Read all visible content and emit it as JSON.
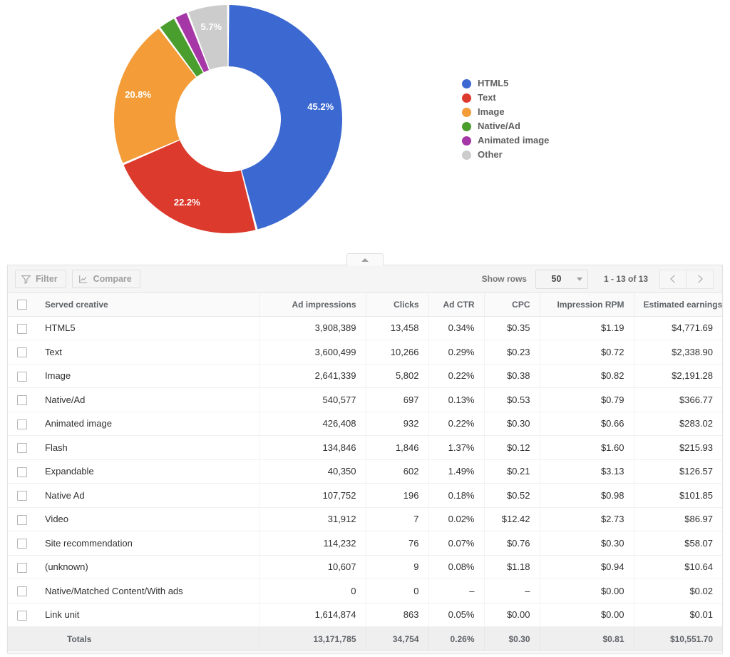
{
  "chart_data": {
    "type": "pie",
    "variant": "donut",
    "title": "",
    "legend_position": "right",
    "categories": [
      "HTML5",
      "Text",
      "Image",
      "Native/Ad",
      "Animated image",
      "Other"
    ],
    "values": [
      45.2,
      22.2,
      20.8,
      2.5,
      1.9,
      5.7
    ],
    "value_unit": "percent",
    "labels_shown": [
      "45.2%",
      "22.2%",
      "20.8%",
      "",
      "",
      "5.7%"
    ],
    "colors": [
      "#3b68d1",
      "#dc3a2c",
      "#f39c38",
      "#4a9e2e",
      "#a637a6",
      "#cccccc"
    ],
    "legend": [
      {
        "label": "HTML5",
        "color": "#3b68d1"
      },
      {
        "label": "Text",
        "color": "#dc3a2c"
      },
      {
        "label": "Image",
        "color": "#f39c38"
      },
      {
        "label": "Native/Ad",
        "color": "#4a9e2e"
      },
      {
        "label": "Animated image",
        "color": "#a637a6"
      },
      {
        "label": "Other",
        "color": "#cccccc"
      }
    ]
  },
  "collapse_tab": {
    "icon": "triangle-up-icon"
  },
  "toolbar": {
    "filter_label": "Filter",
    "compare_label": "Compare",
    "show_rows_label": "Show rows",
    "rows_value": "50",
    "page_range": "1 - 13 of 13",
    "prev_icon": "chevron-left-icon",
    "next_icon": "chevron-right-icon"
  },
  "table": {
    "columns": [
      "Served creative",
      "Ad impressions",
      "Clicks",
      "Ad CTR",
      "CPC",
      "Impression RPM",
      "Estimated earnings"
    ],
    "rows": [
      {
        "name": "HTML5",
        "impressions": "3,908,389",
        "clicks": "13,458",
        "ctr": "0.34%",
        "cpc": "$0.35",
        "rpm": "$1.19",
        "earnings": "$4,771.69"
      },
      {
        "name": "Text",
        "impressions": "3,600,499",
        "clicks": "10,266",
        "ctr": "0.29%",
        "cpc": "$0.23",
        "rpm": "$0.72",
        "earnings": "$2,338.90"
      },
      {
        "name": "Image",
        "impressions": "2,641,339",
        "clicks": "5,802",
        "ctr": "0.22%",
        "cpc": "$0.38",
        "rpm": "$0.82",
        "earnings": "$2,191.28"
      },
      {
        "name": "Native/Ad",
        "impressions": "540,577",
        "clicks": "697",
        "ctr": "0.13%",
        "cpc": "$0.53",
        "rpm": "$0.79",
        "earnings": "$366.77"
      },
      {
        "name": "Animated image",
        "impressions": "426,408",
        "clicks": "932",
        "ctr": "0.22%",
        "cpc": "$0.30",
        "rpm": "$0.66",
        "earnings": "$283.02"
      },
      {
        "name": "Flash",
        "impressions": "134,846",
        "clicks": "1,846",
        "ctr": "1.37%",
        "cpc": "$0.12",
        "rpm": "$1.60",
        "earnings": "$215.93"
      },
      {
        "name": "Expandable",
        "impressions": "40,350",
        "clicks": "602",
        "ctr": "1.49%",
        "cpc": "$0.21",
        "rpm": "$3.13",
        "earnings": "$126.57"
      },
      {
        "name": "Native Ad",
        "impressions": "107,752",
        "clicks": "196",
        "ctr": "0.18%",
        "cpc": "$0.52",
        "rpm": "$0.98",
        "earnings": "$101.85"
      },
      {
        "name": "Video",
        "impressions": "31,912",
        "clicks": "7",
        "ctr": "0.02%",
        "cpc": "$12.42",
        "rpm": "$2.73",
        "earnings": "$86.97"
      },
      {
        "name": "Site recommendation",
        "impressions": "114,232",
        "clicks": "76",
        "ctr": "0.07%",
        "cpc": "$0.76",
        "rpm": "$0.30",
        "earnings": "$58.07"
      },
      {
        "name": "(unknown)",
        "impressions": "10,607",
        "clicks": "9",
        "ctr": "0.08%",
        "cpc": "$1.18",
        "rpm": "$0.94",
        "earnings": "$10.64"
      },
      {
        "name": "Native/Matched Content/With ads",
        "impressions": "0",
        "clicks": "0",
        "ctr": "–",
        "cpc": "–",
        "rpm": "$0.00",
        "earnings": "$0.02"
      },
      {
        "name": "Link unit",
        "impressions": "1,614,874",
        "clicks": "863",
        "ctr": "0.05%",
        "cpc": "$0.00",
        "rpm": "$0.00",
        "earnings": "$0.01"
      }
    ],
    "totals": {
      "name": "Totals",
      "impressions": "13,171,785",
      "clicks": "34,754",
      "ctr": "0.26%",
      "cpc": "$0.30",
      "rpm": "$0.81",
      "earnings": "$10,551.70"
    }
  }
}
